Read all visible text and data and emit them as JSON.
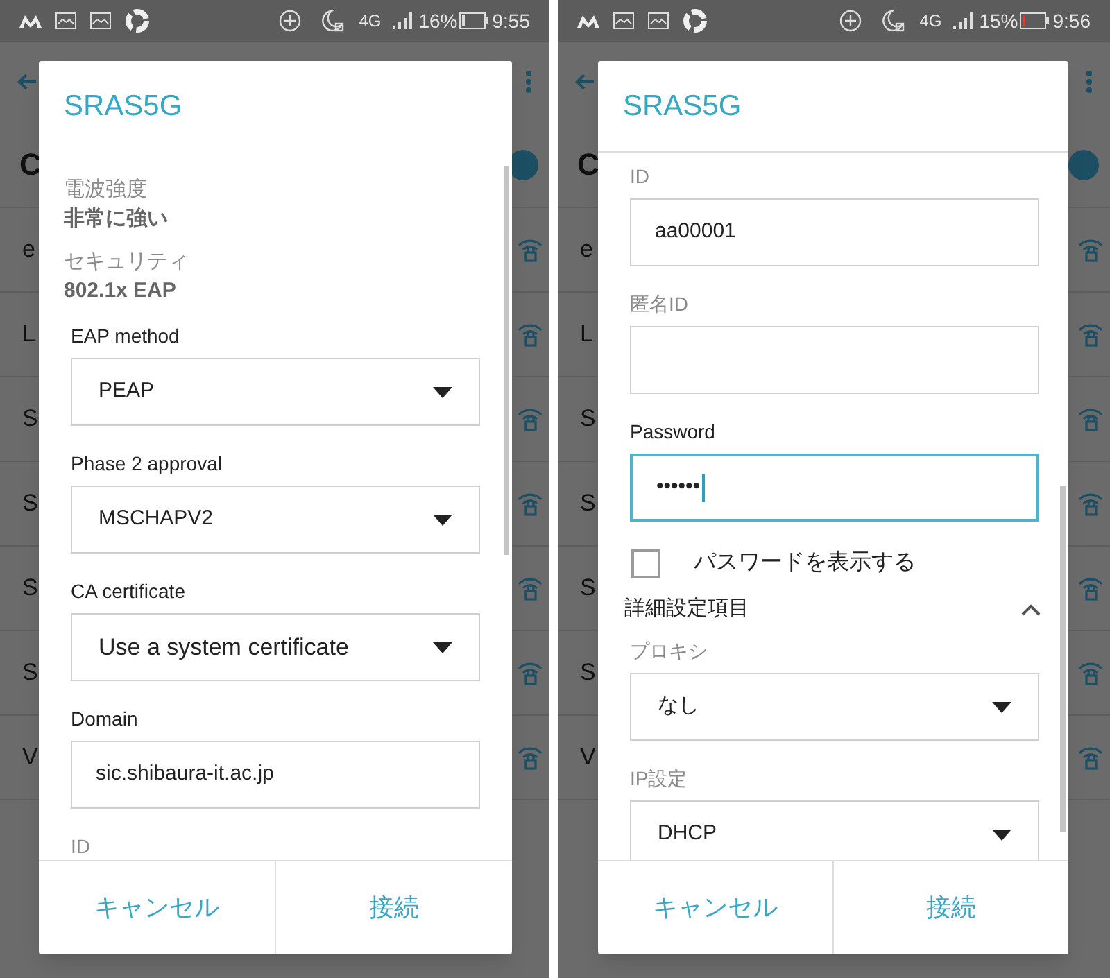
{
  "phones": [
    {
      "status_bar": {
        "network": "4G",
        "battery_text": "16%",
        "battery_low": false,
        "time": "9:55"
      },
      "background": {
        "heading": "C",
        "rows": [
          "e",
          "L",
          "S",
          "S",
          "S",
          "S",
          "V"
        ]
      },
      "dialog": {
        "title": "SRAS5G",
        "scrolled": false,
        "items": [
          {
            "kind": "info",
            "label": "電波強度",
            "value": "非常に強い"
          },
          {
            "kind": "info",
            "label": "セキュリティ",
            "value": "802.1x EAP"
          },
          {
            "kind": "dropdown",
            "label": "EAP method",
            "value": "PEAP",
            "muted": false,
            "large": false
          },
          {
            "kind": "dropdown",
            "label": "Phase 2 approval",
            "value": "MSCHAPV2",
            "muted": false,
            "large": false
          },
          {
            "kind": "dropdown",
            "label": "CA certificate",
            "value": "Use a system certificate",
            "muted": false,
            "large": true
          },
          {
            "kind": "input",
            "label": "Domain",
            "value": "sic.shibaura-it.ac.jp",
            "muted": false,
            "focused": false
          },
          {
            "kind": "label",
            "label": "ID",
            "muted": true
          }
        ],
        "buttons": [
          "キャンセル",
          "接続"
        ]
      }
    },
    {
      "status_bar": {
        "network": "4G",
        "battery_text": "15%",
        "battery_low": true,
        "time": "9:56"
      },
      "background": {
        "heading": "C",
        "rows": [
          "e",
          "L",
          "S",
          "S",
          "S",
          "S",
          "V"
        ]
      },
      "dialog": {
        "title": "SRAS5G",
        "scrolled": true,
        "items": [
          {
            "kind": "input",
            "label": "ID",
            "value": "aa00001",
            "muted": true,
            "focused": false
          },
          {
            "kind": "input",
            "label": "匿名ID",
            "muted": true,
            "focused": false
          },
          {
            "kind": "password",
            "label": "Password",
            "value": "••••••",
            "muted": false,
            "focused": true
          },
          {
            "kind": "checkbox",
            "label": "パスワードを表示する",
            "checked": false
          },
          {
            "kind": "section",
            "label": "詳細設定項目",
            "expanded": true
          },
          {
            "kind": "dropdown",
            "label": "プロキシ",
            "value": "なし",
            "muted": true,
            "large": false
          },
          {
            "kind": "dropdown",
            "label": "IP設定",
            "value": "DHCP",
            "muted": true,
            "large": false
          }
        ],
        "buttons": [
          "キャンセル",
          "接続"
        ]
      }
    }
  ]
}
